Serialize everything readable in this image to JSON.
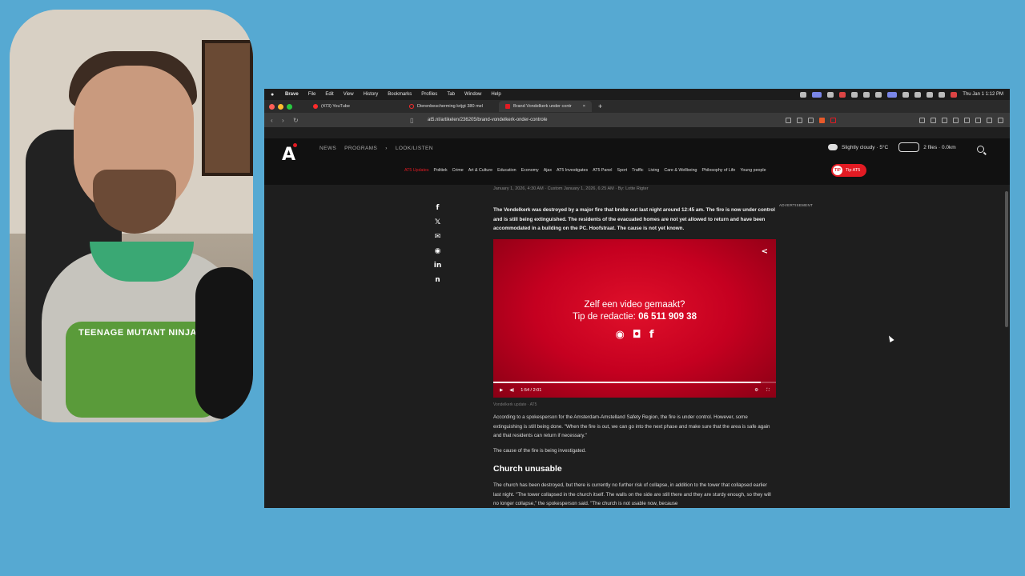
{
  "webcam": {
    "shirt_text": "TEENAGE MUTANT NINJA"
  },
  "menubar": {
    "app": "Brave",
    "items": [
      "File",
      "Edit",
      "View",
      "History",
      "Bookmarks",
      "Profiles",
      "Tab",
      "Window",
      "Help"
    ],
    "clock": "Thu Jan 1  1:12 PM"
  },
  "tabs": [
    {
      "title": "(473) YouTube",
      "color": "#ff2b2b"
    },
    {
      "title": "Dierenbescherming krijgt 380 mel",
      "color": "#ff2b2b"
    },
    {
      "title": "Brand Vondelkerk under contr",
      "color": "#e21b23"
    }
  ],
  "address": {
    "url": "at5.nl/artikelen/236205/brand-vondelkerk-onder-controle"
  },
  "site": {
    "logo": "A",
    "topnav": [
      "NEWS",
      "PROGRAMS",
      "›",
      "LOOK/LISTEN"
    ],
    "weather": "Slightly cloudy · 5°C",
    "traffic": "2 files · 0.0km",
    "categories": [
      "Politiek",
      "Crime",
      "Art & Culture",
      "Education",
      "Economy",
      "Ajax",
      "AT5 Investigates",
      "AT5 Panel",
      "Sport",
      "Traffic",
      "Living",
      "Care & Wellbeing",
      "Philosophy of Life",
      "Young people"
    ],
    "live_label": "AT5 Updates",
    "tip_label": "Tip AT5",
    "tip_icon": "TIP"
  },
  "article": {
    "byline": "January 1, 2026, 4:30 AM · Custom January 1, 2026, 6:25 AM · By: Lotte Rigter",
    "advertisement": "ADVERTISEMENT",
    "lead": "The Vondelkerk was destroyed by a major fire that broke out last night around 12:45 am. The fire is now under control and is still being extinguished. The residents of the evacuated homes are not yet allowed to return and have been accommodated in a building on the PC. Hoofstraat. The cause is not yet known.",
    "video": {
      "line1": "Zelf een video gemaakt?",
      "line2_prefix": "Tip de redactie: ",
      "line2_number": "06 511 909 38",
      "time": "1:54  /  2:01",
      "progress": 0.947
    },
    "caption": "Vondelkerk update · AT5",
    "para1": "According to a spokesperson for the Amsterdam-Amstelland Safety Region, the fire is under control. However, some extinguishing is still being done. \"When the fire is out, we can go into the next phase and make sure that the area is safe again and that residents can return if necessary.\"",
    "para2": "The cause of the fire is being investigated.",
    "heading": "Church unusable",
    "para3": "The church has been destroyed, but there is currently no further risk of collapse, in addition to the tower that collapsed earlier last night. \"The tower collapsed in the church itself. The walls on the side are still there and they are sturdy enough, so they will no longer collapse,\" the spokesperson said. \"The church is not usable now, because"
  }
}
